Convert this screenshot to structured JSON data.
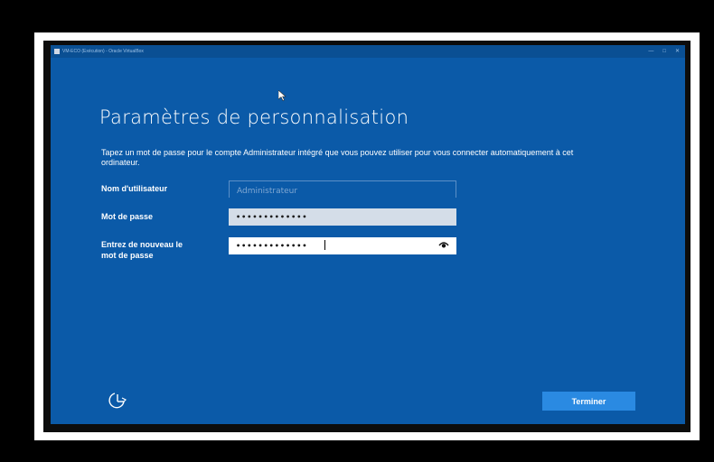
{
  "window": {
    "title": "VM-ECO (Exécution) - Oracle VirtualBox"
  },
  "setup": {
    "heading": "Paramètres de personnalisation",
    "description": "Tapez un mot de passe pour le compte Administrateur intégré que vous pouvez utiliser pour vous connecter automatiquement à cet ordinateur.",
    "username_label": "Nom d'utilisateur",
    "username_placeholder": "Administrateur",
    "password_label": "Mot de passe",
    "password_value": "•••••••••••••",
    "confirm_label_line1": "Entrez de nouveau le",
    "confirm_label_line2": "mot de passe",
    "confirm_value": "•••••••••••••",
    "finish_label": "Terminer"
  },
  "icons": {
    "reveal": "eye-icon",
    "accessibility": "ease-of-access-icon",
    "cursor": "mouse-pointer-icon"
  },
  "colors": {
    "background": "#0b5aa8",
    "button": "#2a8ae2"
  }
}
